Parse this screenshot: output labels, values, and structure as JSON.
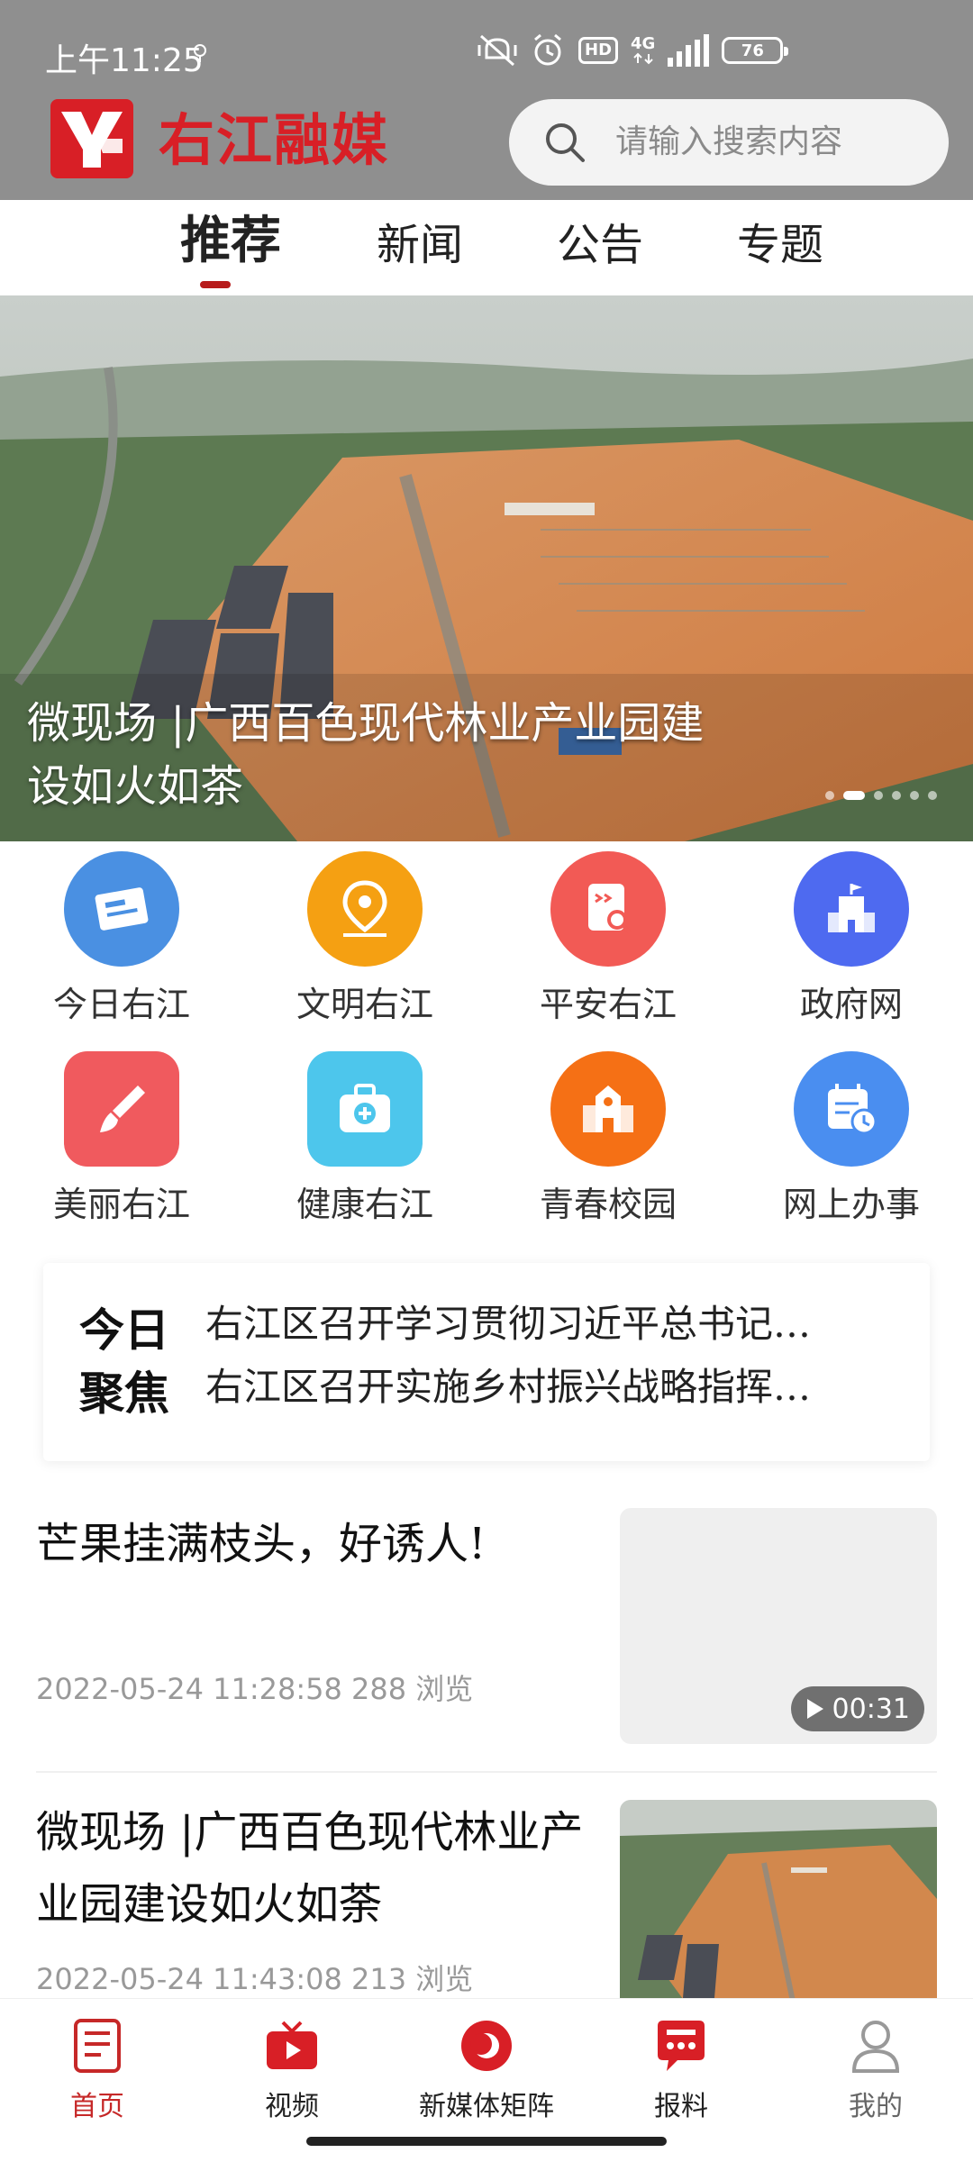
{
  "status_bar": {
    "time": "上午11:25",
    "network": "4G",
    "hd": "HD",
    "battery": "76"
  },
  "header": {
    "brand": "右江融媒",
    "search_placeholder": "请输入搜索内容"
  },
  "tabs": [
    {
      "label": "推荐",
      "active": true
    },
    {
      "label": "新闻",
      "active": false
    },
    {
      "label": "公告",
      "active": false
    },
    {
      "label": "专题",
      "active": false
    }
  ],
  "banner": {
    "title": "微现场 |广西百色现代林业产业园建设如火如茶",
    "page_count": 6,
    "active_index": 1
  },
  "shortcuts": [
    {
      "label": "今日右江",
      "icon": "news-icon",
      "color": "#4a90e2"
    },
    {
      "label": "文明右江",
      "icon": "location-pin-icon",
      "color": "#f5a012"
    },
    {
      "label": "平安右江",
      "icon": "document-search-icon",
      "color": "#f25a55"
    },
    {
      "label": "政府网",
      "icon": "government-building-icon",
      "color": "#4e6af0"
    },
    {
      "label": "美丽右江",
      "icon": "paint-brush-icon",
      "color": "#f05a5e"
    },
    {
      "label": "健康右江",
      "icon": "medical-kit-icon",
      "color": "#4dc6ec"
    },
    {
      "label": "青春校园",
      "icon": "school-icon",
      "color": "#f57015"
    },
    {
      "label": "网上办事",
      "icon": "calendar-clock-icon",
      "color": "#4a8ef0"
    }
  ],
  "focus": {
    "title": "今日聚焦",
    "items": [
      "右江区召开学习贯彻习近平总书记…",
      "右江区召开实施乡村振兴战略指挥…"
    ]
  },
  "news": [
    {
      "title": "芒果挂满枝头，好诱人!",
      "meta": "2022-05-24 11:28:58   288 浏览",
      "duration": "00:31"
    },
    {
      "title": "微现场 |广西百色现代林业产业园建设如火如荼",
      "meta": "2022-05-24 11:43:08   213 浏览"
    }
  ],
  "bottom_nav": [
    {
      "label": "首页",
      "icon": "home-document-icon",
      "active": true
    },
    {
      "label": "视频",
      "icon": "tv-play-icon",
      "active": false
    },
    {
      "label": "新媒体矩阵",
      "icon": "media-matrix-icon",
      "active": false
    },
    {
      "label": "报料",
      "icon": "chat-report-icon",
      "active": false
    },
    {
      "label": "我的",
      "icon": "user-icon",
      "active": false
    }
  ],
  "colors": {
    "brand_red": "#d81f26",
    "header_gray": "#8f8f8f"
  }
}
